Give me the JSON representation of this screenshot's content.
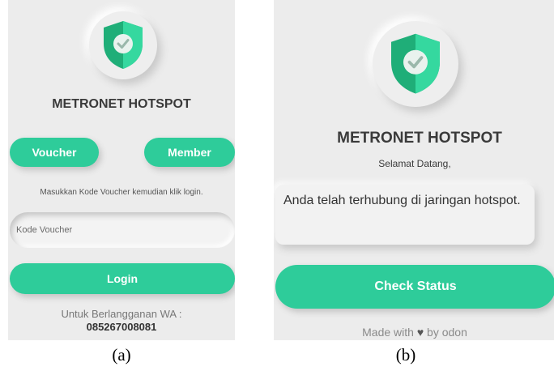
{
  "panel_a": {
    "logo": "shield-check-icon",
    "title": "METRONET HOTSPOT",
    "voucher_button": "Voucher",
    "member_button": "Member",
    "instruction": "Masukkan Kode Voucher kemudian klik login.",
    "voucher_input": {
      "value": "",
      "placeholder": "Kode Voucher"
    },
    "login_button": "Login",
    "subscribe_label": "Untuk Berlangganan WA :",
    "subscribe_phone": "085267008081"
  },
  "panel_b": {
    "logo": "shield-check-icon",
    "title": "METRONET HOTSPOT",
    "subtitle": "Selamat Datang,",
    "message": "Anda telah terhubung di jaringan hotspot.",
    "check_status_button": "Check Status",
    "footer_prefix": "Made with",
    "footer_heart": "♥",
    "footer_suffix": "by odon"
  },
  "captions": {
    "a": "(a)",
    "b": "(b)"
  },
  "colors": {
    "accent": "#2ecc9a",
    "shield_light": "#35d89f",
    "shield_dark": "#1fae78",
    "panel_background": "#ececec"
  }
}
